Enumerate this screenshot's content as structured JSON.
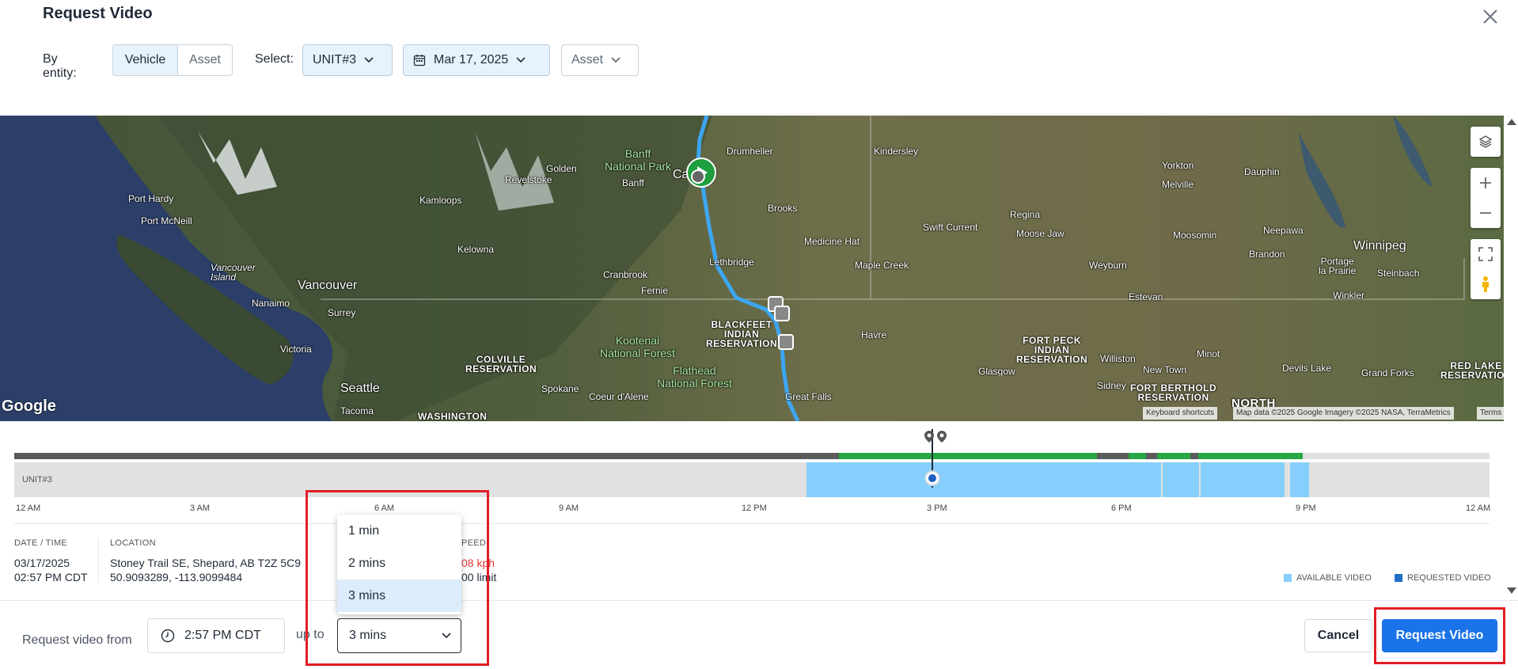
{
  "dialog": {
    "title": "Request Video"
  },
  "filters": {
    "by_entity_label": "By entity:",
    "entity_options": [
      "Vehicle",
      "Asset"
    ],
    "entity_selected": "Vehicle",
    "select_label": "Select:",
    "unit_value": "UNIT#3",
    "date_value": "Mar 17, 2025",
    "asset_value": "Asset"
  },
  "map": {
    "labels": {
      "drumheller": "Drumheller",
      "kindersley": "Kindersley",
      "yorkton": "Yorkton",
      "dauphin": "Dauphin",
      "banff_np": "Banff\nNational Park",
      "golden": "Golden",
      "melville": "Melville",
      "revelstoke": "Revelstoke",
      "banff": "Banff",
      "calgary": "Calgary",
      "port_hardy": "Port Hardy",
      "brooks": "Brooks",
      "regina": "Regina",
      "port_mcneill": "Port McNeill",
      "kamloops": "Kamloops",
      "swift_current": "Swift Current",
      "moose_jaw": "Moose Jaw",
      "moosomin": "Moosomin",
      "neepawa": "Neepawa",
      "medicine_hat": "Medicine Hat",
      "winnipeg": "Winnipeg",
      "kelowna": "Kelowna",
      "lethbridge": "Lethbridge",
      "maple_creek": "Maple Creek",
      "brandon": "Brandon",
      "weyburn": "Weyburn",
      "portage": "Portage\nla Prairie",
      "steinbach": "Steinbach",
      "vancouver_island": "Vancouver\nIsland",
      "cranbrook": "Cranbrook",
      "vancouver": "Vancouver",
      "fernie": "Fernie",
      "estevan": "Estevan",
      "winkler": "Winkler",
      "nanaimo": "Nanaimo",
      "surrey": "Surrey",
      "blackfeet": "BLACKFEET\nINDIAN\nRESERVATION",
      "havre": "Havre",
      "kootenai": "Kootenai\nNational Forest",
      "fort_peck": "FORT PECK\nINDIAN\nRESERVATION",
      "victoria": "Victoria",
      "colville": "COLVILLE\nRESERVATION",
      "minot": "Minot",
      "williston": "Williston",
      "new_town": "New Town",
      "glasgow": "Glasgow",
      "flathead": "Flathead\nNational Forest",
      "devils_lake": "Devils Lake",
      "red_lake": "RED LAKE\nRESERVATION",
      "grand_forks": "Grand Forks",
      "seattle": "Seattle",
      "spokane": "Spokane",
      "coeur": "Coeur d'Alene",
      "sidney": "Sidney",
      "fort_berthold": "FORT BERTHOLD\nRESERVATION",
      "great_falls": "Great Falls",
      "north": "NORTH",
      "tacoma": "Tacoma",
      "washington": "WASHINGTON"
    },
    "google": "Google",
    "keyboard_shortcuts": "Keyboard shortcuts",
    "map_data": "Map data ©2025 Google Imagery ©2025 NASA, TerraMetrics",
    "terms": "Terms"
  },
  "timeline": {
    "row_label": "UNIT#3",
    "ticks": [
      "12 AM",
      "3 AM",
      "6 AM",
      "9 AM",
      "12 PM",
      "3 PM",
      "6 PM",
      "9 PM",
      "12 AM"
    ],
    "colors": {
      "driving": "#27a745",
      "stopped": "#5b5b5b",
      "available": "#86cefb",
      "requested": "#1d6fc8"
    }
  },
  "info": {
    "date_time_header": "DATE / TIME",
    "date": "03/17/2025",
    "time": "02:57 PM CDT",
    "location_header": "LOCATION",
    "address": "Stoney Trail SE, Shepard, AB T2Z 5C9",
    "coords": "50.9093289, -113.9099484",
    "speed_header": "PEED",
    "speed": "08 kph",
    "limit": "00 limit"
  },
  "legend": {
    "available": "AVAILABLE VIDEO",
    "requested": "REQUESTED VIDEO"
  },
  "footer": {
    "request_from_label": "Request video from",
    "time_value": "2:57 PM CDT",
    "up_to_label": "up to",
    "duration_value": "3 mins",
    "duration_options": [
      "1 min",
      "2 mins",
      "3 mins"
    ],
    "duration_selected": "3 mins",
    "cancel_label": "Cancel",
    "request_label": "Request Video"
  }
}
